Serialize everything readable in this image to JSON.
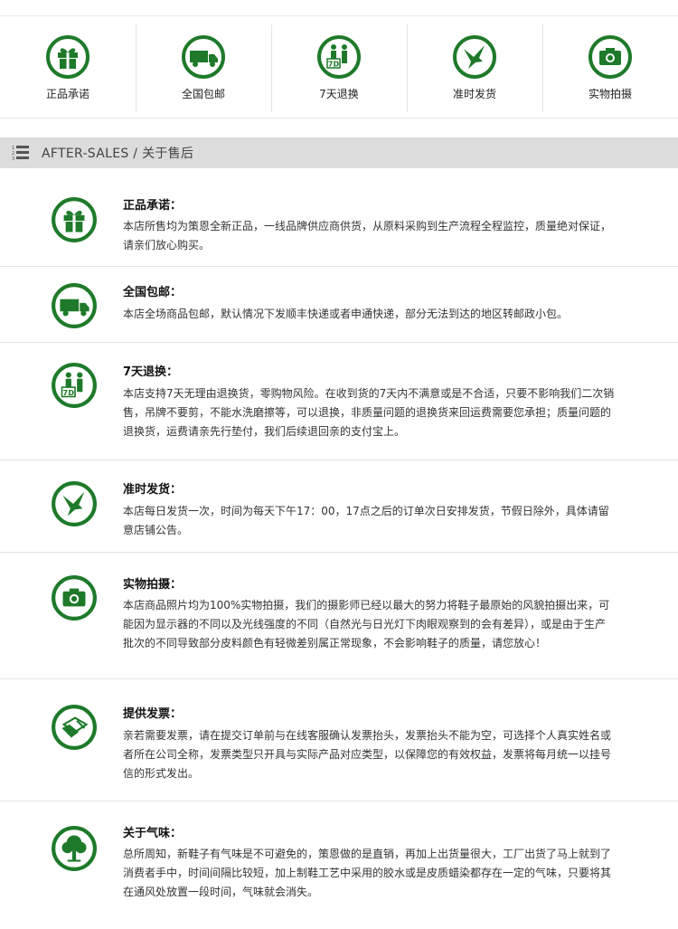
{
  "features": [
    {
      "label": "正品承诺",
      "icon": "gift-icon"
    },
    {
      "label": "全国包邮",
      "icon": "truck-icon"
    },
    {
      "label": "7天退换",
      "icon": "seven-day-return-icon"
    },
    {
      "label": "准时发货",
      "icon": "bird-icon"
    },
    {
      "label": "实物拍摄",
      "icon": "camera-icon"
    }
  ],
  "section": {
    "title": "AFTER-SALES / 关于售后",
    "icon": "list-icon"
  },
  "items": [
    {
      "title": "正品承诺：",
      "desc": "本店所售均为策恩全新正品，一线品牌供应商供货，从原料采购到生产流程全程监控，质量绝对保证，请亲们放心购买。",
      "icon": "gift-icon"
    },
    {
      "title": "全国包邮：",
      "desc": "本店全场商品包邮，默认情况下发顺丰快递或者申通快递，部分无法到达的地区转邮政小包。",
      "icon": "truck-icon"
    },
    {
      "title": "7天退换：",
      "desc": "本店支持7天无理由退换货，零购物风险。在收到货的7天内不满意或是不合适，只要不影响我们二次销售，吊牌不要剪，不能水洗磨擦等，可以退换，非质量问题的退换货来回运费需要您承担；质量问题的退换货，运费请亲先行垫付，我们后续退回亲的支付宝上。",
      "icon": "seven-day-return-icon"
    },
    {
      "title": "准时发货：",
      "desc": "本店每日发货一次，时间为每天下午17：00，17点之后的订单次日安排发货，节假日除外，具体请留意店铺公告。",
      "icon": "bird-icon"
    },
    {
      "title": "实物拍摄：",
      "desc": "本店商品照片均为100%实物拍摄，我们的摄影师已经以最大的努力将鞋子最原始的风貌拍摄出来，可能因为显示器的不同以及光线强度的不同（自然光与日光灯下肉眼观察到的会有差异），或是由于生产批次的不同导致部分皮料颜色有轻微差别属正常现象，不会影响鞋子的质量，请您放心！",
      "icon": "camera-icon"
    },
    {
      "title": "提供发票：",
      "desc": "亲若需要发票，请在提交订单前与在线客服确认发票抬头，发票抬头不能为空，可选择个人真实姓名或者所在公司全称，发票类型只开具与实际产品对应类型，以保障您的有效权益，发票将每月统一以挂号信的形式发出。",
      "icon": "invoice-icon"
    },
    {
      "title": "关于气味：",
      "desc": "总所周知，新鞋子有气味是不可避免的，策恩做的是直销，再加上出货量很大，工厂出货了马上就到了消费者手中，时间间隔比较短，加上制鞋工艺中采用的胶水或是皮质蜡染都存在一定的气味，只要将其在通风处放置一段时间，气味就会消失。",
      "icon": "tree-icon"
    }
  ],
  "colors": {
    "brand_green": "#1e7a2a",
    "bar_gray": "#dcdcdc"
  }
}
